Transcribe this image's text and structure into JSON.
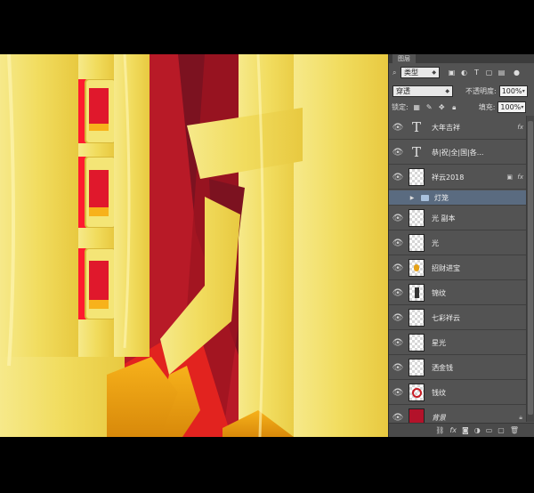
{
  "panel": {
    "tab_label": "图层",
    "filter_label": "类型",
    "blend_mode": "穿透",
    "opacity_label": "不透明度:",
    "opacity_value": "100%",
    "lock_label": "锁定:",
    "fill_label": "填充:",
    "fill_value": "100%"
  },
  "layers": [
    {
      "name": "大年吉祥",
      "kind": "text",
      "fx": true
    },
    {
      "name": "恭|祝|全|国|各...",
      "kind": "text"
    },
    {
      "name": "祥云2018",
      "kind": "smart",
      "fx": true
    },
    {
      "name": "灯笼",
      "kind": "group",
      "selected": true
    },
    {
      "name": "光 副本",
      "kind": "pixel"
    },
    {
      "name": "光",
      "kind": "pixel"
    },
    {
      "name": "招财进宝",
      "kind": "pixel"
    },
    {
      "name": "锦纹",
      "kind": "pixel"
    },
    {
      "name": "七彩祥云",
      "kind": "pixel"
    },
    {
      "name": "星光",
      "kind": "pixel"
    },
    {
      "name": "洒金钱",
      "kind": "pixel"
    },
    {
      "name": "钱纹",
      "kind": "pixel"
    },
    {
      "name": "背景",
      "kind": "background"
    }
  ],
  "colors": {
    "gold": "#f2df6a",
    "red": "#c81d25",
    "panel_bg": "#535353",
    "selected": "#5a6b80"
  }
}
